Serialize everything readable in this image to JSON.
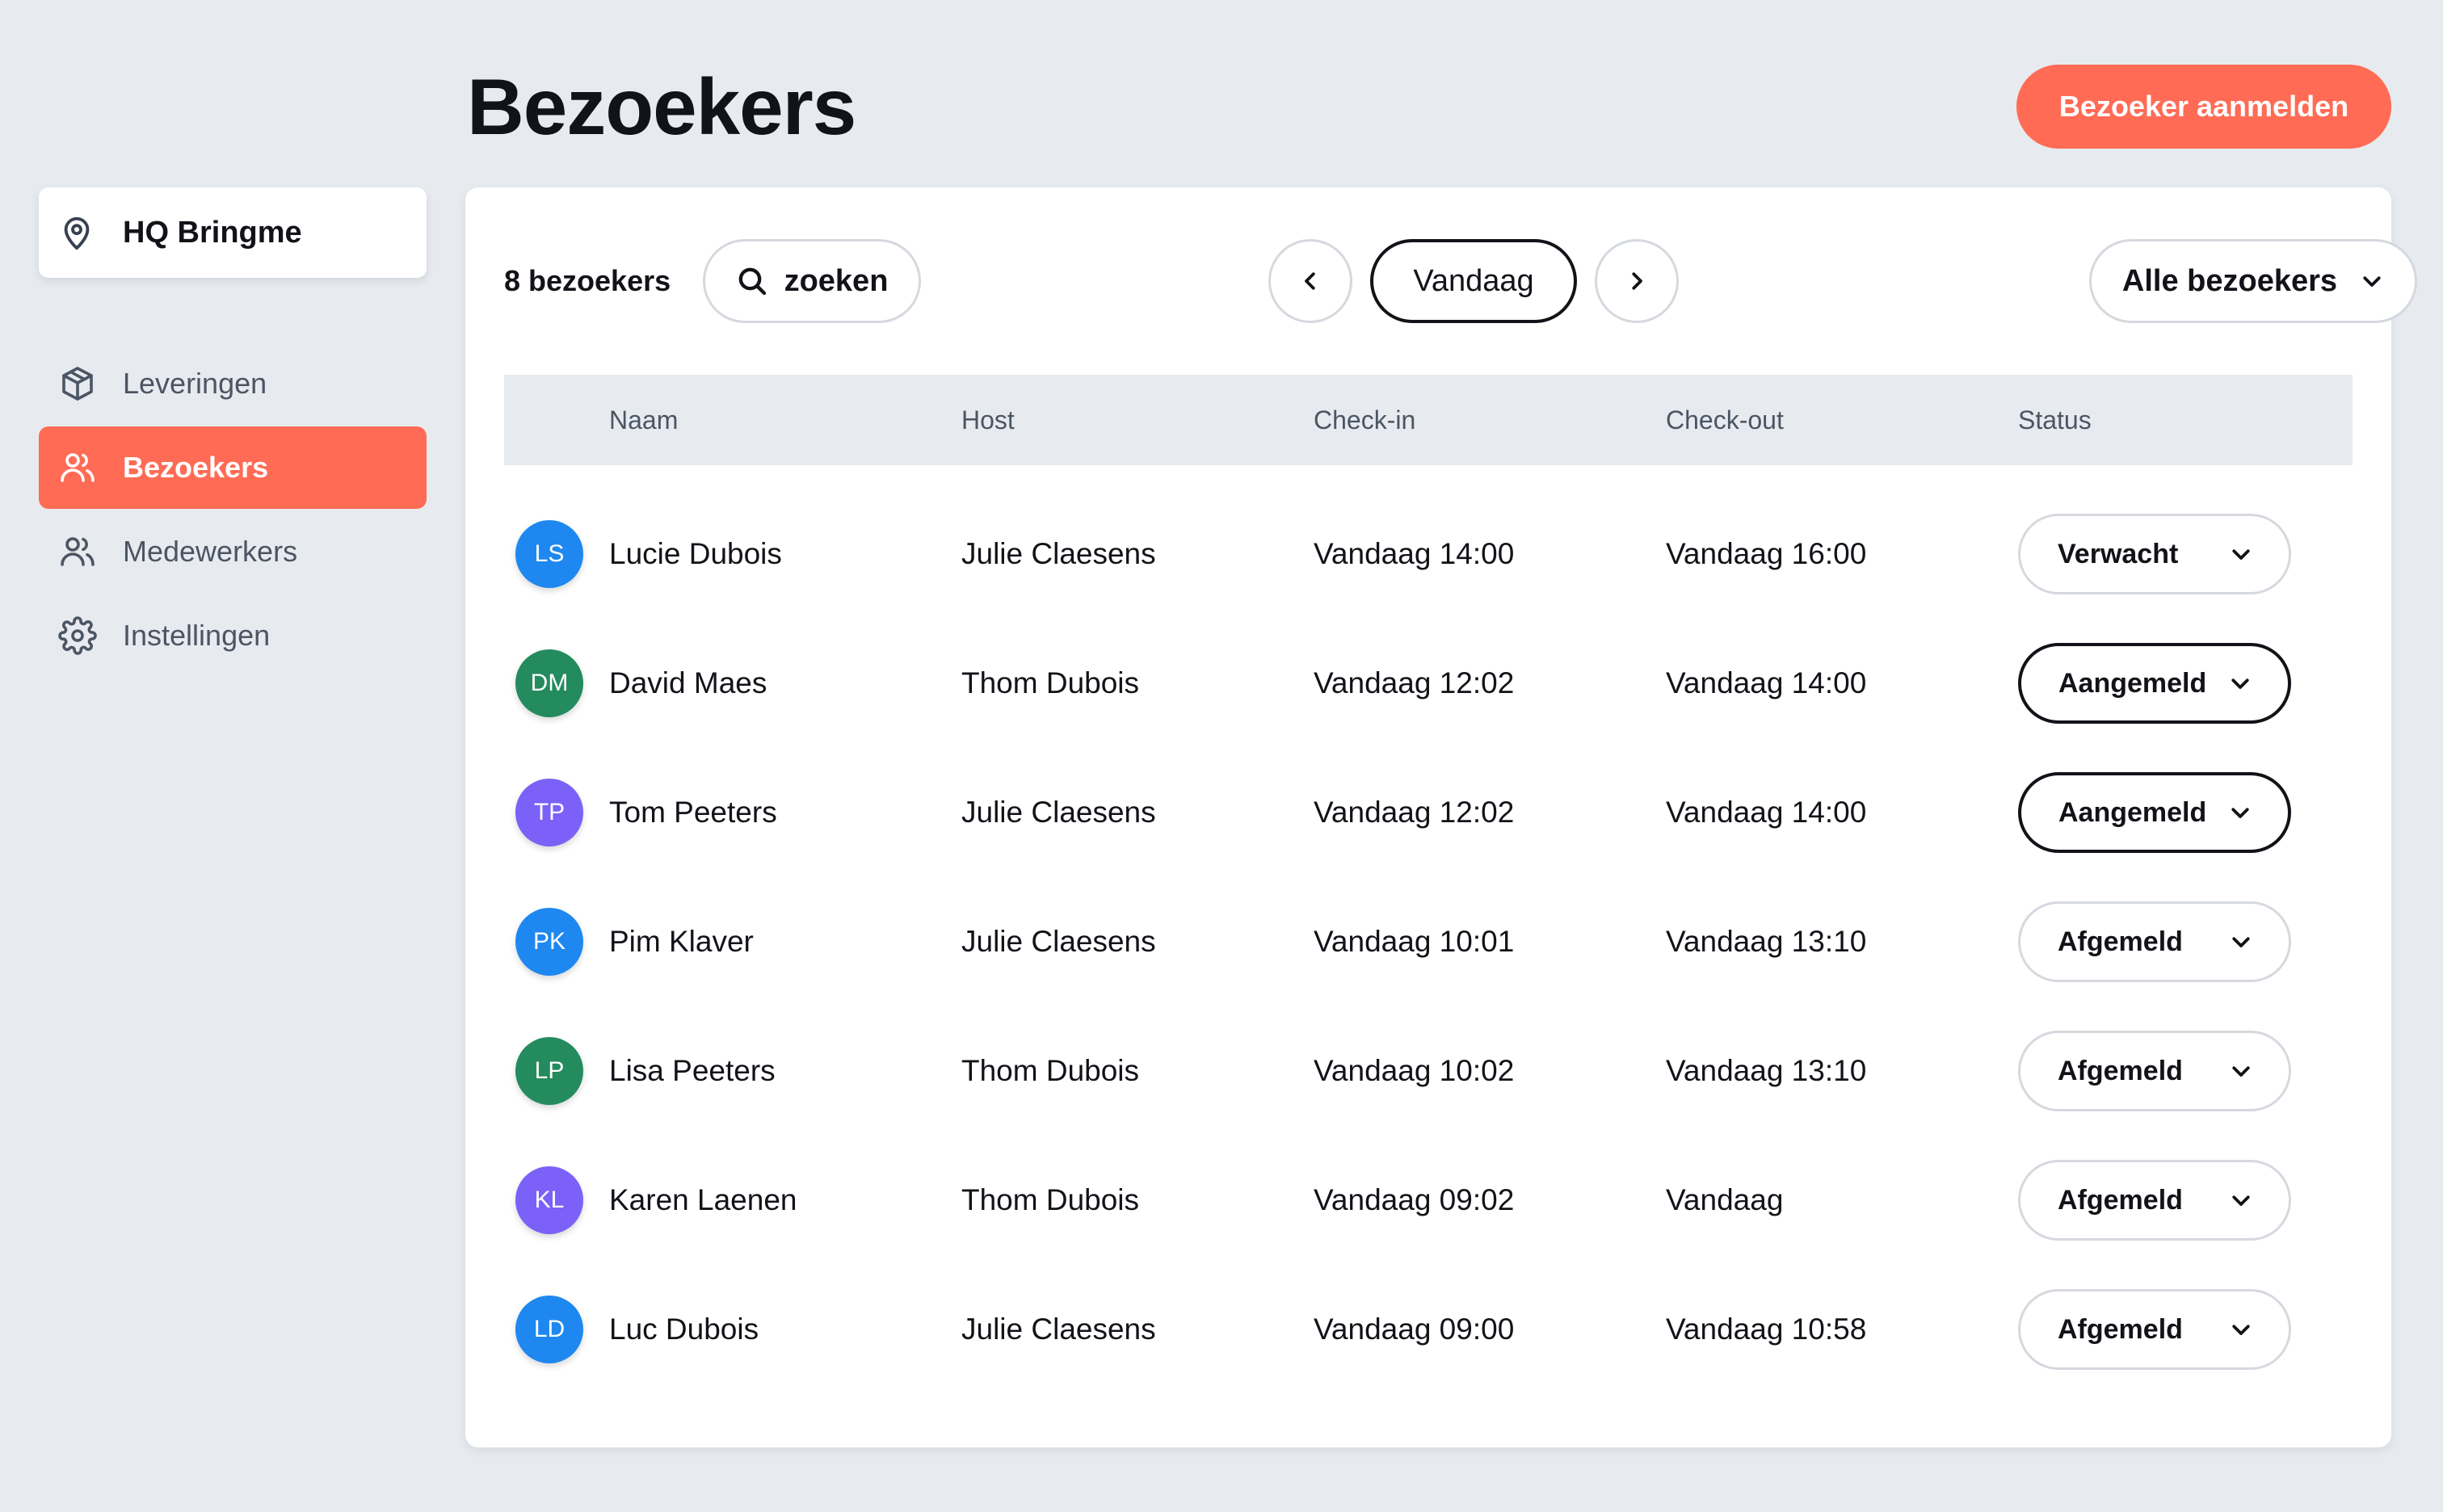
{
  "header": {
    "title": "Bezoekers",
    "primary_action": "Bezoeker aanmelden"
  },
  "location": {
    "name": "HQ Bringme",
    "icon": "map-pin-icon"
  },
  "sidebar": {
    "items": [
      {
        "label": "Leveringen",
        "icon": "package-icon",
        "active": false
      },
      {
        "label": "Bezoekers",
        "icon": "users-icon",
        "active": true
      },
      {
        "label": "Medewerkers",
        "icon": "users-icon",
        "active": false
      },
      {
        "label": "Instellingen",
        "icon": "gear-icon",
        "active": false
      }
    ]
  },
  "toolbar": {
    "count": "8 bezoekers",
    "search_label": "zoeken",
    "date_label": "Vandaag",
    "filter_label": "Alle bezoekers"
  },
  "table": {
    "columns": [
      "Naam",
      "Host",
      "Check-in",
      "Check-out",
      "Status"
    ],
    "rows": [
      {
        "initials": "LS",
        "avatar_color": "#1e88f0",
        "name": "Lucie Dubois",
        "host": "Julie Claesens",
        "check_in": "Vandaag 14:00",
        "check_out": "Vandaag 16:00",
        "status": "Verwacht",
        "status_active": false
      },
      {
        "initials": "DM",
        "avatar_color": "#238b5e",
        "name": "David Maes",
        "host": "Thom Dubois",
        "check_in": "Vandaag 12:02",
        "check_out": "Vandaag 14:00",
        "status": "Aangemeld",
        "status_active": true
      },
      {
        "initials": "TP",
        "avatar_color": "#7b61f8",
        "name": "Tom Peeters",
        "host": "Julie Claesens",
        "check_in": "Vandaag 12:02",
        "check_out": "Vandaag 14:00",
        "status": "Aangemeld",
        "status_active": true
      },
      {
        "initials": "PK",
        "avatar_color": "#1e88f0",
        "name": "Pim Klaver",
        "host": "Julie Claesens",
        "check_in": "Vandaag 10:01",
        "check_out": "Vandaag 13:10",
        "status": "Afgemeld",
        "status_active": false
      },
      {
        "initials": "LP",
        "avatar_color": "#238b5e",
        "name": "Lisa Peeters",
        "host": "Thom Dubois",
        "check_in": "Vandaag 10:02",
        "check_out": "Vandaag 13:10",
        "status": "Afgemeld",
        "status_active": false
      },
      {
        "initials": "KL",
        "avatar_color": "#7b61f8",
        "name": "Karen Laenen",
        "host": "Thom Dubois",
        "check_in": "Vandaag 09:02",
        "check_out": "Vandaag",
        "status": "Afgemeld",
        "status_active": false
      },
      {
        "initials": "LD",
        "avatar_color": "#1e88f0",
        "name": "Luc Dubois",
        "host": "Julie Claesens",
        "check_in": "Vandaag 09:00",
        "check_out": "Vandaag 10:58",
        "status": "Afgemeld",
        "status_active": false
      }
    ]
  },
  "colors": {
    "accent": "#ff6b55",
    "background": "#e7ebf0",
    "text": "#111318",
    "muted": "#4b5563"
  }
}
